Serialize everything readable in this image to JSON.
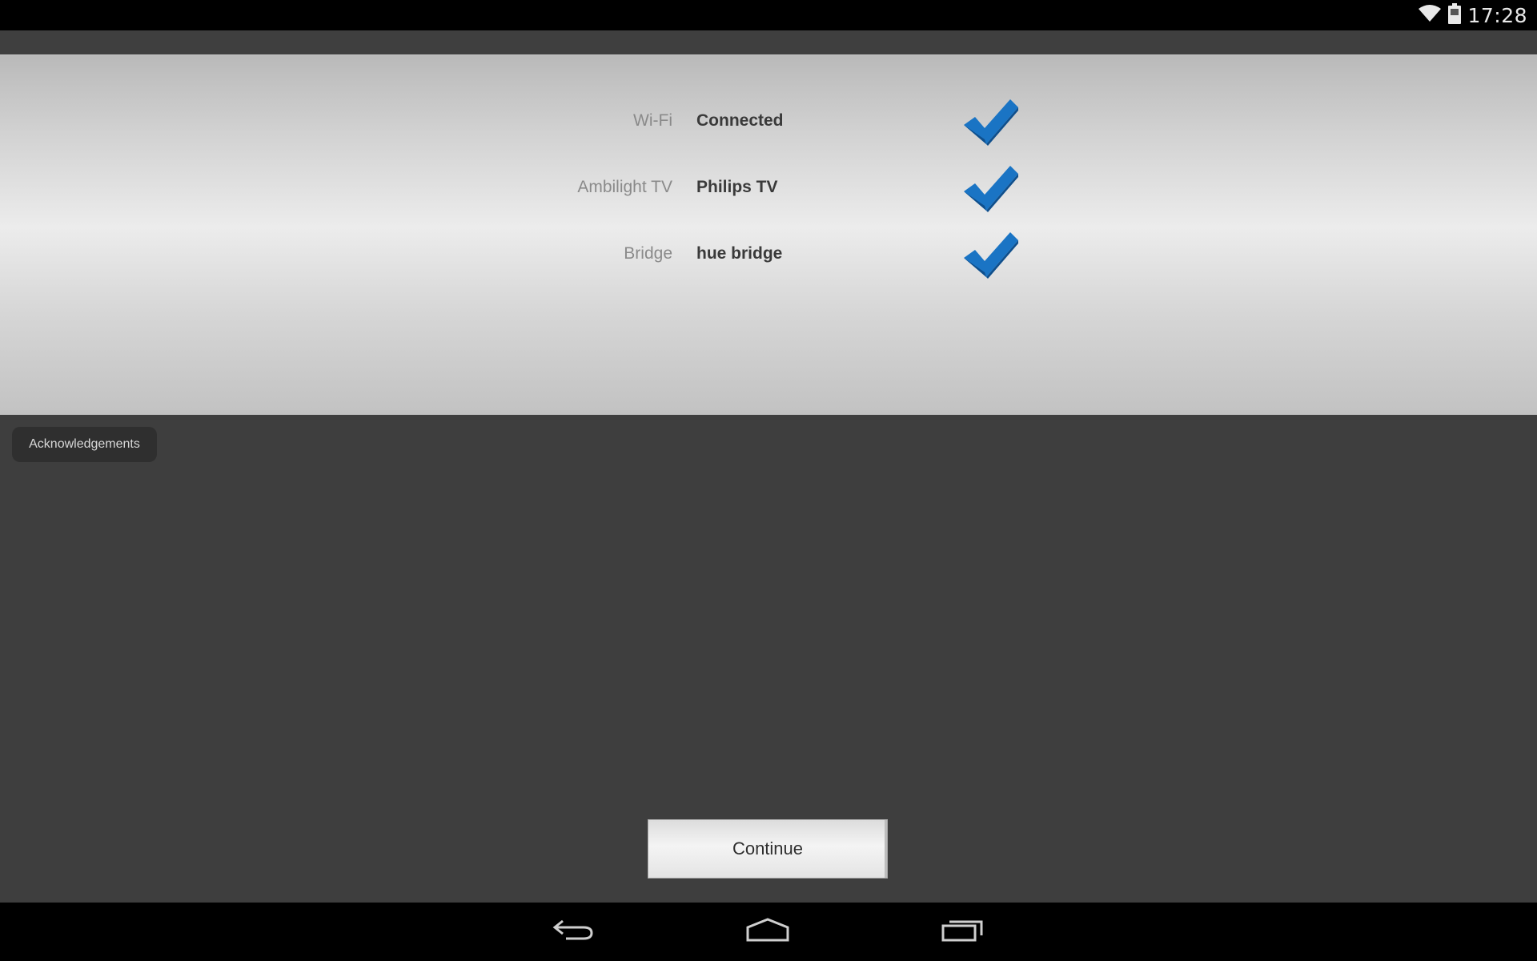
{
  "status_bar": {
    "time": "17:28",
    "icons": [
      "wifi-icon",
      "battery-icon"
    ]
  },
  "connection_status": {
    "rows": [
      {
        "label": "Wi-Fi",
        "value": "Connected",
        "icon": "checkmark-icon"
      },
      {
        "label": "Ambilight TV",
        "value": "Philips TV",
        "icon": "checkmark-icon"
      },
      {
        "label": "Bridge",
        "value": "hue bridge",
        "icon": "checkmark-icon"
      }
    ]
  },
  "acknowledgements_label": "Acknowledgements",
  "continue_label": "Continue",
  "nav_bar": {
    "buttons": [
      "back-icon",
      "home-icon",
      "recent-apps-icon"
    ]
  },
  "colors": {
    "check_blue": "#1a74c4",
    "check_dark": "#0f4f8c",
    "background": "#3e3e3e"
  }
}
